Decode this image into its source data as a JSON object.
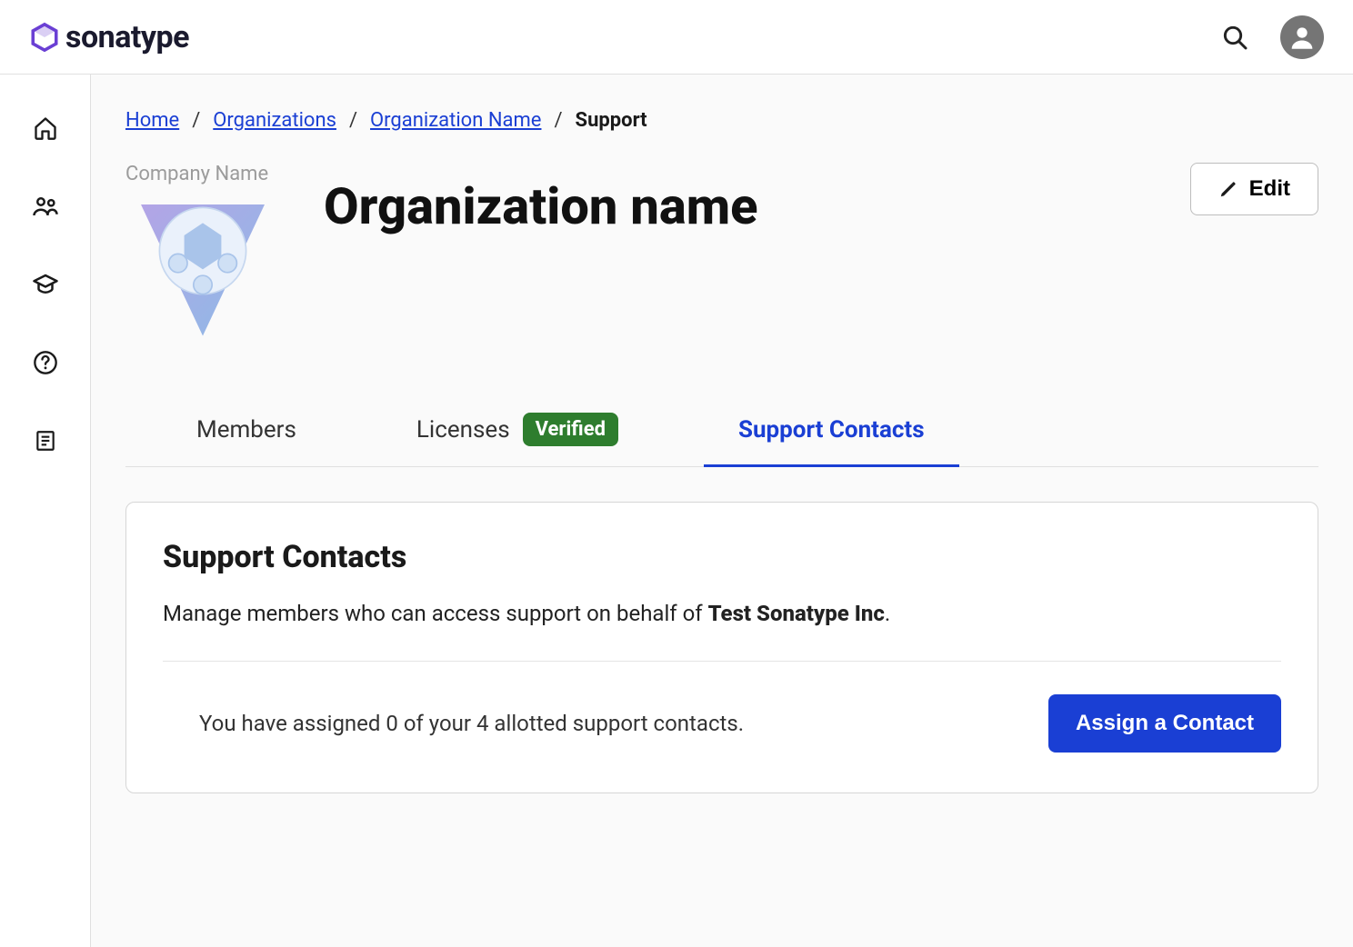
{
  "header": {
    "brand": "sonatype"
  },
  "breadcrumb": {
    "items": [
      {
        "label": "Home",
        "link": true
      },
      {
        "label": "Organizations",
        "link": true
      },
      {
        "label": "Organization Name",
        "link": true
      },
      {
        "label": "Support",
        "link": false
      }
    ]
  },
  "org": {
    "logo_label": "Company Name",
    "title": "Organization name",
    "edit_label": "Edit"
  },
  "tabs": {
    "items": [
      {
        "label": "Members",
        "active": false
      },
      {
        "label": "Licenses",
        "badge": "Verified",
        "active": false
      },
      {
        "label": "Support Contacts",
        "active": true
      }
    ]
  },
  "card": {
    "title": "Support Contacts",
    "desc_prefix": "Manage members who can access support on behalf of ",
    "desc_bold": "Test Sonatype Inc",
    "desc_suffix": ".",
    "assign_text": "You have assigned 0 of your 4 allotted support contacts.",
    "assign_button": "Assign a Contact"
  }
}
